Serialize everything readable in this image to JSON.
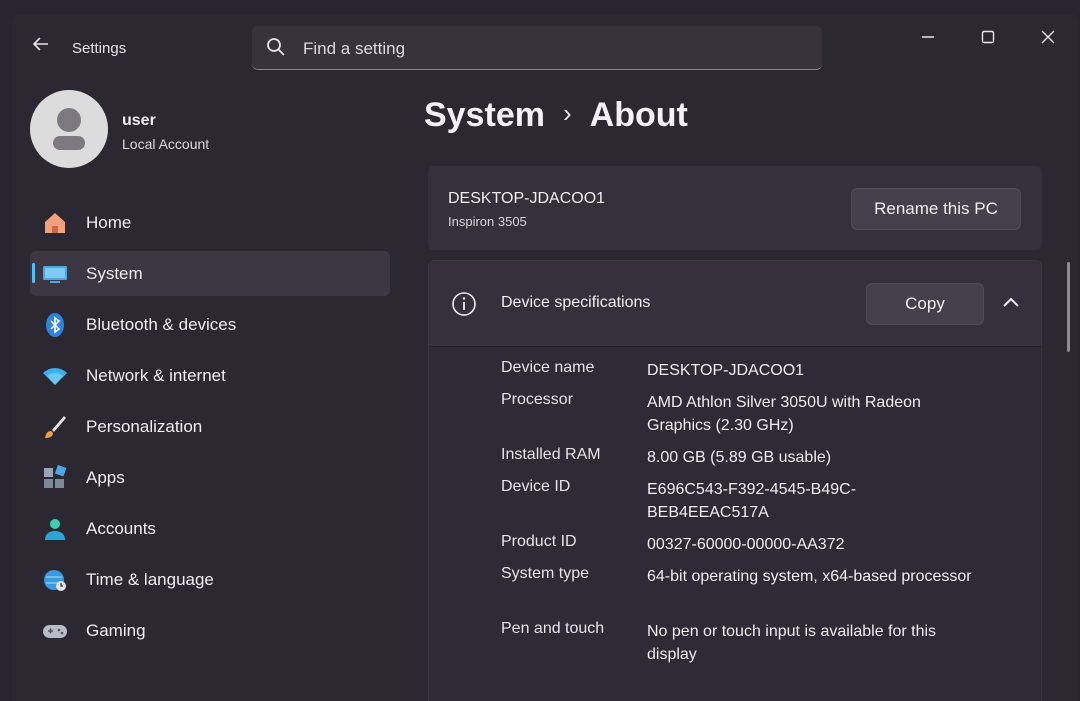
{
  "window": {
    "title": "Settings"
  },
  "search": {
    "placeholder": "Find a setting"
  },
  "profile": {
    "name": "user",
    "account_type": "Local Account"
  },
  "nav": {
    "items": [
      {
        "label": "Home",
        "icon": "home-icon"
      },
      {
        "label": "System",
        "icon": "monitor-icon",
        "active": true
      },
      {
        "label": "Bluetooth & devices",
        "icon": "bluetooth-icon"
      },
      {
        "label": "Network & internet",
        "icon": "wifi-icon"
      },
      {
        "label": "Personalization",
        "icon": "brush-icon"
      },
      {
        "label": "Apps",
        "icon": "apps-icon"
      },
      {
        "label": "Accounts",
        "icon": "person-icon"
      },
      {
        "label": "Time & language",
        "icon": "globe-clock-icon"
      },
      {
        "label": "Gaming",
        "icon": "gamepad-icon"
      }
    ]
  },
  "breadcrumb": {
    "parent": "System",
    "separator": "›",
    "current": "About"
  },
  "device": {
    "name": "DESKTOP-JDACOO1",
    "model": "Inspiron 3505",
    "rename_label": "Rename this PC"
  },
  "specs": {
    "title": "Device specifications",
    "copy_label": "Copy",
    "rows": [
      {
        "key": "Device name",
        "value": "DESKTOP-JDACOO1"
      },
      {
        "key": "Processor",
        "value": "AMD Athlon Silver 3050U with Radeon Graphics    (2.30 GHz)"
      },
      {
        "key": "Installed RAM",
        "value": "8.00 GB (5.89 GB usable)"
      },
      {
        "key": "Device ID",
        "value": "E696C543-F392-4545-B49C-BEB4EEAC517A"
      },
      {
        "key": "Product ID",
        "value": "00327-60000-00000-AA372"
      },
      {
        "key": "System type",
        "value": "64-bit operating system, x64-based processor"
      },
      {
        "key": "Pen and touch",
        "value": "No pen or touch input is available for this display"
      }
    ]
  },
  "colors": {
    "accent": "#4cc2ff",
    "background": "#2c2832",
    "card": "#35303b"
  }
}
